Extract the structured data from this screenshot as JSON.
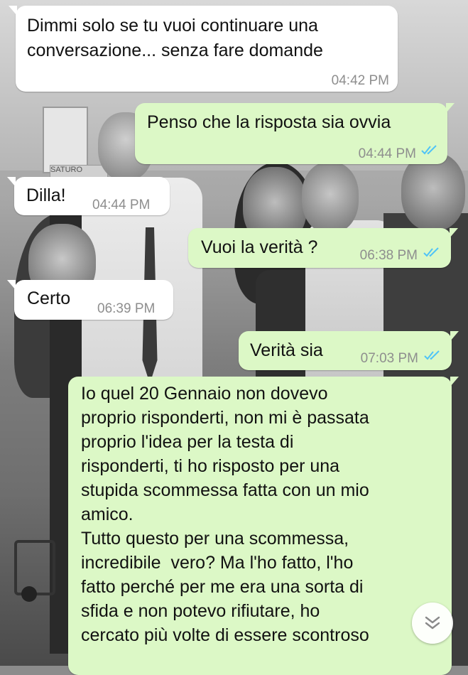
{
  "accent": {
    "tick_color": "#4fc3f7",
    "incoming_bg": "#ffffff",
    "outgoing_bg": "#dcf8c6"
  },
  "wallpaper": {
    "sign_text": "SATURO"
  },
  "messages": [
    {
      "direction": "in",
      "lines": [
        "Dimmi solo se tu vuoi continuare una",
        "conversazione... senza fare domande"
      ],
      "time": "04:42 PM"
    },
    {
      "direction": "out",
      "lines": [
        "Penso che la risposta sia ovvia"
      ],
      "time": "04:44 PM",
      "status_icon": "double-check-read"
    },
    {
      "direction": "in",
      "lines": [
        "Dilla!"
      ],
      "time": "04:44 PM"
    },
    {
      "direction": "out",
      "lines": [
        "Vuoi la verità ?"
      ],
      "time": "06:38 PM",
      "status_icon": "double-check-read"
    },
    {
      "direction": "in",
      "lines": [
        "Certo"
      ],
      "time": "06:39 PM"
    },
    {
      "direction": "out",
      "lines": [
        "Verità sia"
      ],
      "time": "07:03 PM",
      "status_icon": "double-check-read"
    },
    {
      "direction": "out",
      "lines": [
        "Io quel 20 Gennaio non dovevo",
        "proprio risponderti, non mi è passata",
        "proprio l'idea per la testa di",
        "risponderti, ti ho risposto per una",
        "stupida scommessa fatta con un mio",
        "amico.",
        "Tutto questo per una scommessa,",
        "incredibile  vero? Ma l'ho fatto, l'ho",
        "fatto perché per me era una sorta di",
        "sfida e non potevo rifiutare, ho",
        "cercato più volte di essere scontroso"
      ]
    }
  ],
  "scroll_down": {
    "icon": "double-chevron-down-icon"
  }
}
